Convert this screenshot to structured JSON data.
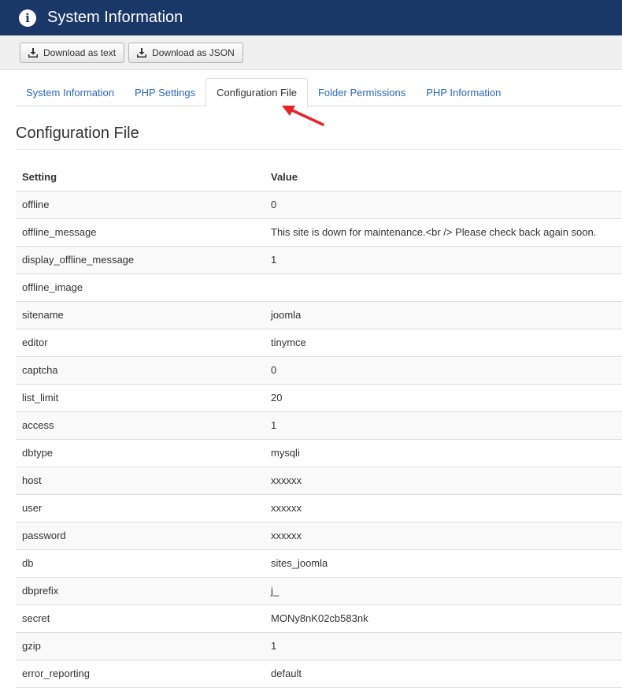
{
  "header": {
    "title": "System Information"
  },
  "toolbar": {
    "download_text": "Download as text",
    "download_json": "Download as JSON"
  },
  "tabs": [
    {
      "label": "System Information",
      "active": false
    },
    {
      "label": "PHP Settings",
      "active": false
    },
    {
      "label": "Configuration File",
      "active": true
    },
    {
      "label": "Folder Permissions",
      "active": false
    },
    {
      "label": "PHP Information",
      "active": false
    }
  ],
  "section": {
    "title": "Configuration File"
  },
  "table": {
    "headers": [
      "Setting",
      "Value"
    ],
    "rows": [
      {
        "setting": "offline",
        "value": "0"
      },
      {
        "setting": "offline_message",
        "value": "This site is down for maintenance.<br /> Please check back again soon."
      },
      {
        "setting": "display_offline_message",
        "value": "1"
      },
      {
        "setting": "offline_image",
        "value": ""
      },
      {
        "setting": "sitename",
        "value": "joomla"
      },
      {
        "setting": "editor",
        "value": "tinymce"
      },
      {
        "setting": "captcha",
        "value": "0"
      },
      {
        "setting": "list_limit",
        "value": "20"
      },
      {
        "setting": "access",
        "value": "1"
      },
      {
        "setting": "dbtype",
        "value": "mysqli"
      },
      {
        "setting": "host",
        "value": "xxxxxx"
      },
      {
        "setting": "user",
        "value": "xxxxxx"
      },
      {
        "setting": "password",
        "value": "xxxxxx"
      },
      {
        "setting": "db",
        "value": "sites_joomla"
      },
      {
        "setting": "dbprefix",
        "value": "j_"
      },
      {
        "setting": "secret",
        "value": "MONy8nK02cb583nk"
      },
      {
        "setting": "gzip",
        "value": "1"
      },
      {
        "setting": "error_reporting",
        "value": "default"
      }
    ]
  },
  "colors": {
    "header_bg": "#1a3867",
    "link": "#2a69b8",
    "annotation_arrow": "#e8222a"
  }
}
